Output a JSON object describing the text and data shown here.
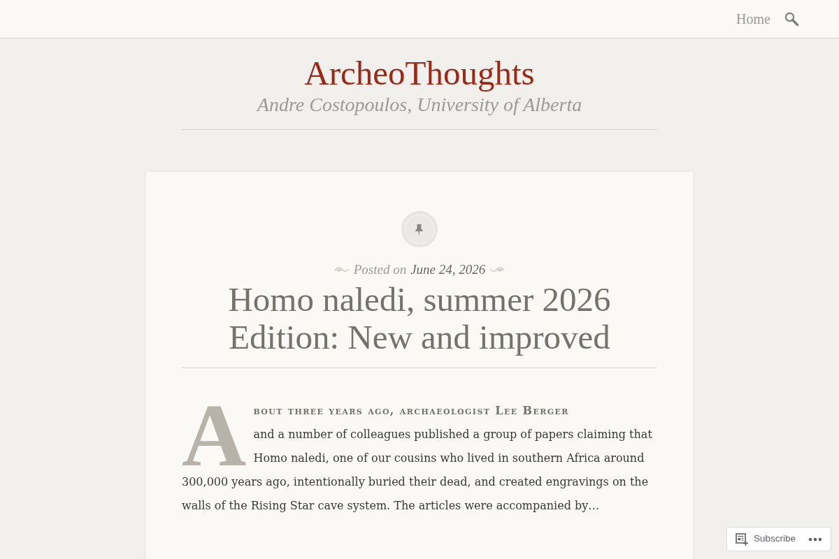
{
  "navbar": {
    "links": [
      {
        "label": "Home"
      }
    ]
  },
  "site": {
    "title": "ArcheoThoughts",
    "tagline": "Andre Costopoulos, University of Alberta"
  },
  "post": {
    "sticky": true,
    "meta": {
      "label": "Posted on",
      "date": "June 24, 2026"
    },
    "title": "Homo naledi, summer 2026 Edition: New and improved",
    "excerpt": {
      "lead_in": "About three years ago, archaeologist Lee Berger",
      "text": "and a number of colleagues published a group of papers claiming that Homo naledi, one of our cousins who lived in southern Africa around 300,000 years ago, intentionally buried their dead, and created engravings on the walls of the Rising Star cave system. The articles were accompanied by…"
    }
  },
  "subscribe_bar": {
    "label": "Subscribe"
  }
}
